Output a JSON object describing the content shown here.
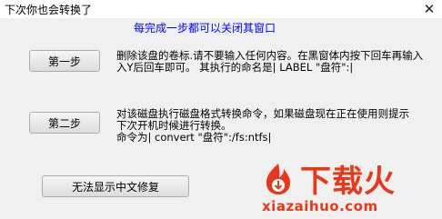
{
  "window": {
    "title": "下次你也会转换了"
  },
  "headline": "每完成一步都可以关闭其窗口",
  "step1": {
    "button": "第一步",
    "lines": [
      "删除该盘的卷标.请不要输入任何内容。在黑窗体内按下回车再输入",
      "入Y后回车即可。   其执行的命名是| LABEL \"盘符\":|"
    ]
  },
  "step2": {
    "button": "第二步",
    "lines": [
      "对该磁盘执行磁盘格式转换命令，如果磁盘现在正在使用则提示",
      "下次开机时候进行转换。",
      "命令为|  convert \"盘符\":/fs:ntfs|"
    ]
  },
  "repair_button": "无法显示中文修复",
  "watermark": {
    "text": "下载火",
    "url": "xiazaihuo.com",
    "color": "#e8381a"
  }
}
